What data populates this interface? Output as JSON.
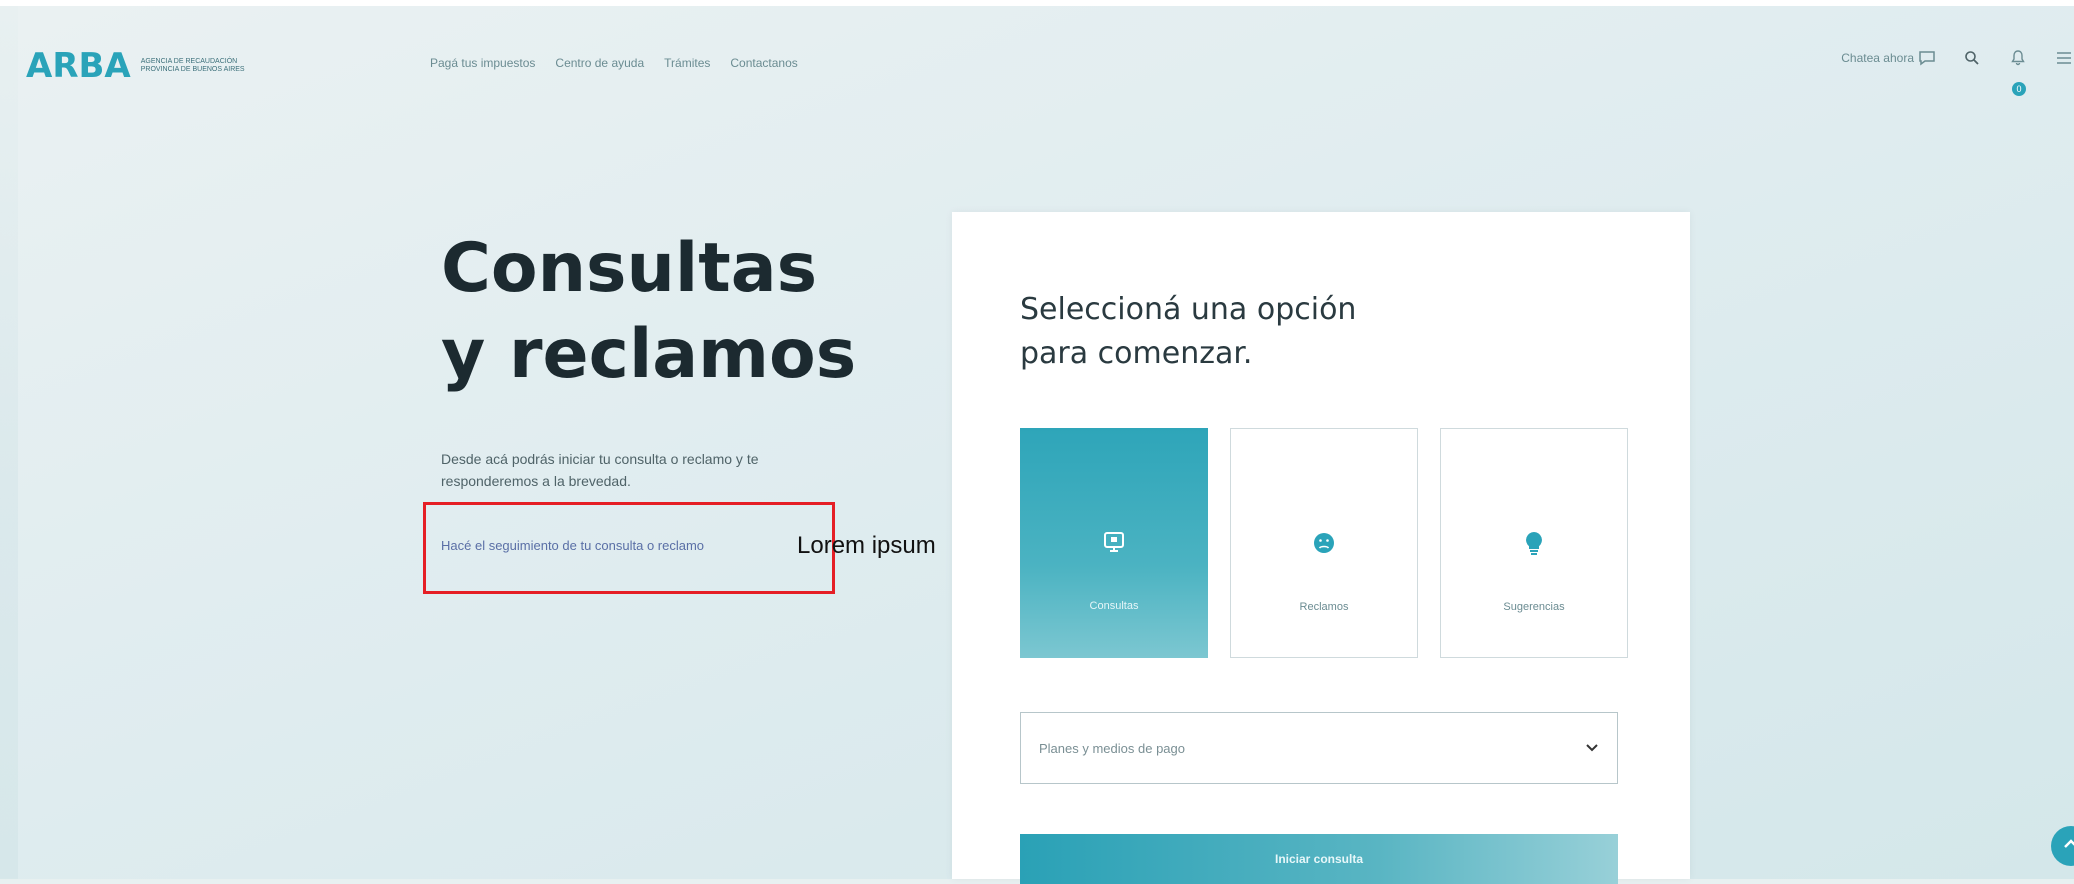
{
  "header": {
    "logo": {
      "mark": "ARBA",
      "subtitle_line1": "AGENCIA DE RECAUDACIÓN",
      "subtitle_line2": "PROVINCIA DE BUENOS AIRES"
    },
    "nav": [
      {
        "label": "Pagá tus impuestos"
      },
      {
        "label": "Centro de ayuda"
      },
      {
        "label": "Trámites"
      },
      {
        "label": "Contactanos"
      }
    ],
    "chat_label": "Chatea ahora",
    "notification_count": "0"
  },
  "hero": {
    "title_line1": "Consultas",
    "title_line2": "y reclamos",
    "description": "Desde acá podrás iniciar tu consulta o reclamo y te responderemos a la brevedad.",
    "tracking_link": "Hacé el seguimiento de tu consulta o reclamo",
    "overlay_text": "Lorem ipsum"
  },
  "card": {
    "title_line1": "Seleccioná una opción",
    "title_line2": "para comenzar.",
    "options": [
      {
        "label": "Consultas",
        "icon": "monitor-icon",
        "selected": true
      },
      {
        "label": "Reclamos",
        "icon": "sad-face-icon",
        "selected": false
      },
      {
        "label": "Sugerencias",
        "icon": "lightbulb-icon",
        "selected": false
      }
    ],
    "select_value": "Planes y medios de pago",
    "submit_label": "Iniciar consulta"
  },
  "colors": {
    "accent": "#2aa3b9",
    "highlight_border": "#e51e25"
  }
}
